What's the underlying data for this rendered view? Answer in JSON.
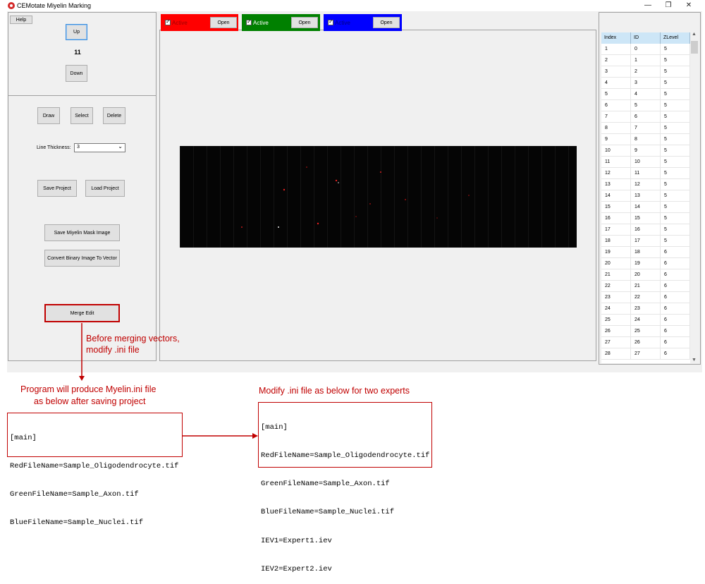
{
  "window": {
    "title": "CEMotate Miyelin Marking",
    "controls": {
      "minimize": "—",
      "maximize": "❐",
      "close": "✕"
    }
  },
  "left": {
    "help": "Help",
    "up": "Up",
    "counter": "11",
    "down": "Down",
    "draw": "Draw",
    "select": "Select",
    "delete": "Delete",
    "line_thickness_label": "Line Thickness:",
    "line_thickness_value": "3",
    "save_project": "Save Project",
    "load_project": "Load Project",
    "save_mask": "Save Miyelin Mask Image",
    "convert": "Convert Binary Image To Vector",
    "merge_edit": "Merge Edit"
  },
  "channels": [
    {
      "label": "Active",
      "open": "Open",
      "color": "#ff0000"
    },
    {
      "label": "Active",
      "open": "Open",
      "color": "#008000"
    },
    {
      "label": "Active",
      "open": "Open",
      "color": "#0000ff"
    }
  ],
  "table": {
    "columns": [
      "Index",
      "ID",
      "ZLevel"
    ],
    "rows": [
      [
        "1",
        "0",
        "5"
      ],
      [
        "2",
        "1",
        "5"
      ],
      [
        "3",
        "2",
        "5"
      ],
      [
        "4",
        "3",
        "5"
      ],
      [
        "5",
        "4",
        "5"
      ],
      [
        "6",
        "5",
        "5"
      ],
      [
        "7",
        "6",
        "5"
      ],
      [
        "8",
        "7",
        "5"
      ],
      [
        "9",
        "8",
        "5"
      ],
      [
        "10",
        "9",
        "5"
      ],
      [
        "11",
        "10",
        "5"
      ],
      [
        "12",
        "11",
        "5"
      ],
      [
        "13",
        "12",
        "5"
      ],
      [
        "14",
        "13",
        "5"
      ],
      [
        "15",
        "14",
        "5"
      ],
      [
        "16",
        "15",
        "5"
      ],
      [
        "17",
        "16",
        "5"
      ],
      [
        "18",
        "17",
        "5"
      ],
      [
        "19",
        "18",
        "6"
      ],
      [
        "20",
        "19",
        "6"
      ],
      [
        "21",
        "20",
        "6"
      ],
      [
        "22",
        "21",
        "6"
      ],
      [
        "23",
        "22",
        "6"
      ],
      [
        "24",
        "23",
        "6"
      ],
      [
        "25",
        "24",
        "6"
      ],
      [
        "26",
        "25",
        "6"
      ],
      [
        "27",
        "26",
        "6"
      ],
      [
        "28",
        "27",
        "6"
      ]
    ]
  },
  "annotations": {
    "note_merge_1": "Before merging vectors,",
    "note_merge_2": "modify .ini file",
    "note_program_1": "Program will produce Myelin.ini file",
    "note_program_2": "as below after saving project",
    "note_modify": "Modify .ini file as below for two experts",
    "ini_original": [
      "[main]",
      "RedFileName=Sample_Oligodendrocyte.tif",
      "GreenFileName=Sample_Axon.tif",
      "BlueFileName=Sample_Nuclei.tif"
    ],
    "ini_modified": [
      "[main]",
      "RedFileName=Sample_Oligodendrocyte.tif",
      "GreenFileName=Sample_Axon.tif",
      "BlueFileName=Sample_Nuclei.tif",
      "IEV1=Expert1.iev",
      "IEV2=Expert2.iev"
    ]
  },
  "colors": {
    "annotation": "#c00000",
    "accent": "#0078d7"
  }
}
